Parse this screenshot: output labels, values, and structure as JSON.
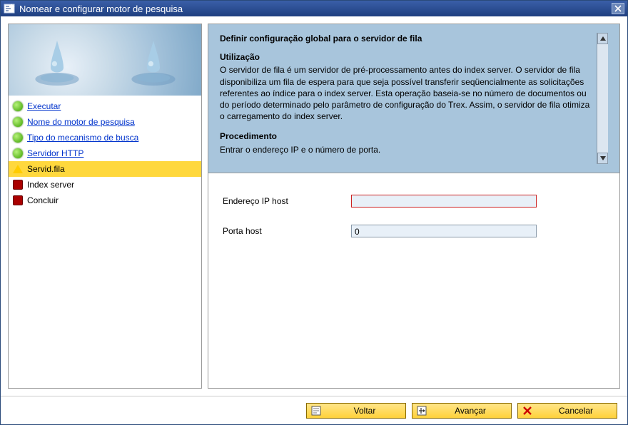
{
  "titlebar": {
    "title": "Nomear e configurar motor de pesquisa"
  },
  "sidebar": {
    "steps": [
      {
        "label": "Executar",
        "link": true,
        "state": "green"
      },
      {
        "label": "Nome do motor de pesquisa",
        "link": true,
        "state": "green"
      },
      {
        "label": "Tipo do mecanismo de busca",
        "link": true,
        "state": "green"
      },
      {
        "label": "Servidor HTTP",
        "link": true,
        "state": "green"
      },
      {
        "label": "Servid.fila",
        "link": false,
        "state": "yellow",
        "selected": true
      },
      {
        "label": "Index server",
        "link": false,
        "state": "red"
      },
      {
        "label": "Concluir",
        "link": false,
        "state": "red"
      }
    ]
  },
  "instructions": {
    "heading": "Definir configuração global para o servidor de fila",
    "section1_title": "Utilização",
    "section1_body": "O servidor de fila é um servidor de pré-processamento antes do index server. O servidor de fila disponibiliza um fila de espera para que seja possível transferir seqüencialmente as solicitações referentes ao índice para o index server. Esta operação baseia-se no número de documentos ou do período determinado pelo parâmetro de configuração do Trex. Assim, o servidor de fila otimiza o carregamento do index server.",
    "section2_title": "Procedimento",
    "section2_body": "Entrar o endereço IP e o número de porta."
  },
  "form": {
    "ip_label": "Endereço IP host",
    "ip_value": "",
    "port_label": "Porta host",
    "port_value": "0"
  },
  "buttons": {
    "back": "Voltar",
    "next": "Avançar",
    "cancel": "Cancelar"
  }
}
